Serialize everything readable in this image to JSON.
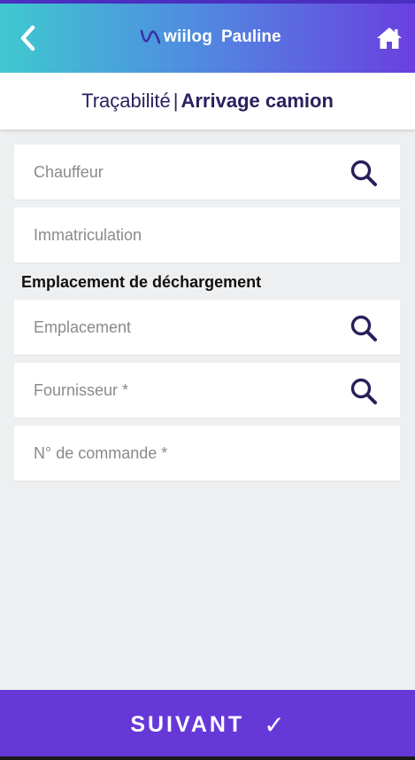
{
  "header": {
    "brand_name": "wiilog",
    "user_name": "Pauline",
    "icons": [
      "chevron-left-icon",
      "wiilog-logo",
      "home-icon"
    ]
  },
  "title_bar": {
    "section": "Traçabilité",
    "separator": "|",
    "page": "Arrivage camion"
  },
  "form": {
    "chauffeur": {
      "placeholder": "Chauffeur",
      "value": ""
    },
    "immatriculation": {
      "placeholder": "Immatriculation",
      "value": ""
    },
    "section_label": "Emplacement de déchargement",
    "emplacement": {
      "placeholder": "Emplacement",
      "value": ""
    },
    "fournisseur": {
      "placeholder": "Fournisseur *",
      "value": ""
    },
    "commande": {
      "placeholder": "N° de commande *",
      "value": ""
    }
  },
  "footer": {
    "submit_label": "SUIVANT",
    "submit_icon": "✓"
  },
  "colors": {
    "header_gradient": [
      "#3fc9cf",
      "#4f8ee0",
      "#6a3fe0"
    ],
    "title_text": "#2b2160",
    "accent": "#6638d8",
    "icon_dark": "#2a1f5a",
    "background": "#eeeff1"
  }
}
